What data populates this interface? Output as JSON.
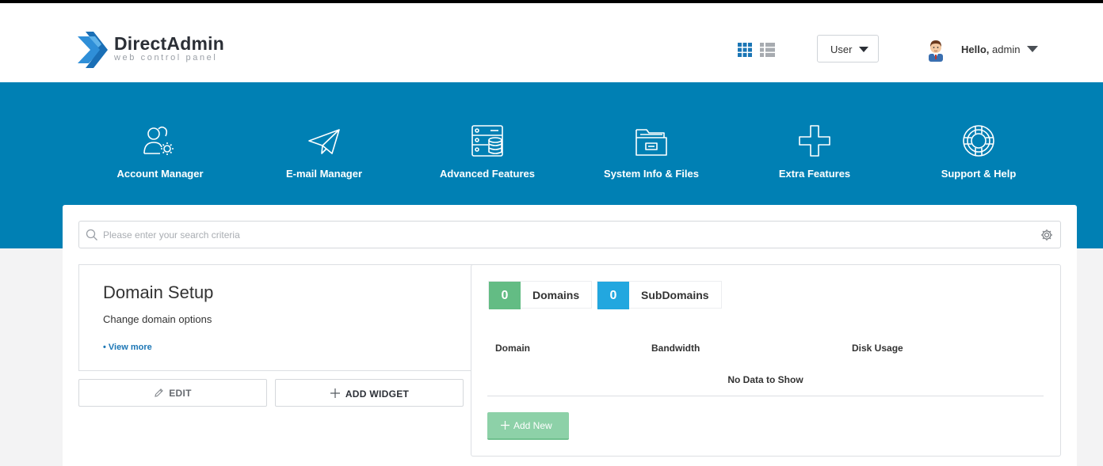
{
  "header": {
    "logo_title": "DirectAdmin",
    "logo_subtitle": "web control panel",
    "role_selector": {
      "value": "User"
    },
    "user": {
      "greeting": "Hello,",
      "name": "admin"
    },
    "view_icons": [
      "grid-view-icon",
      "list-view-icon"
    ]
  },
  "nav": {
    "items": [
      {
        "label": "Account Manager",
        "icon": "users-gear-icon"
      },
      {
        "label": "E-mail Manager",
        "icon": "paper-plane-icon"
      },
      {
        "label": "Advanced Features",
        "icon": "server-database-icon"
      },
      {
        "label": "System Info & Files",
        "icon": "folder-icon"
      },
      {
        "label": "Extra Features",
        "icon": "plus-icon"
      },
      {
        "label": "Support & Help",
        "icon": "lifebuoy-icon"
      }
    ]
  },
  "search": {
    "placeholder": "Please enter your search criteria",
    "value": ""
  },
  "widget": {
    "title": "Domain Setup",
    "description": "Change domain options",
    "view_more": "• View more",
    "edit_label": "EDIT",
    "add_widget_label": "ADD WIDGET"
  },
  "domains": {
    "stats": [
      {
        "count": "0",
        "label": "Domains"
      },
      {
        "count": "0",
        "label": "SubDomains"
      }
    ],
    "columns": [
      "Domain",
      "Bandwidth",
      "Disk Usage"
    ],
    "empty_message": "No Data to Show",
    "add_new_label": "Add New"
  },
  "colors": {
    "brand_blue": "#0080b4",
    "domains_green": "#63bc84",
    "subdomains_blue": "#22a7df",
    "add_new_green": "#8dd1a8"
  }
}
